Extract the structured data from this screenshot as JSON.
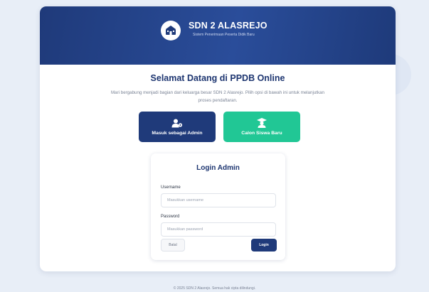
{
  "header": {
    "school_name": "SDN 2 ALASREJO",
    "subtitle": "Sistem Penerimaan Peserta Didik Baru",
    "logo_icon": "school-building-icon"
  },
  "intro": {
    "title": "Selamat Datang di PPDB Online",
    "description": "Mari bergabung menjadi bagian dari keluarga besar SDN 2 Alasrejo. Pilih opsi di bawah ini untuk melanjutkan proses pendaftaran."
  },
  "roles": {
    "admin": {
      "label": "Masuk sebagai Admin",
      "icon": "user-gear-icon",
      "color": "#1f3a7a"
    },
    "siswa": {
      "label": "Calon Siswa Baru",
      "icon": "graduate-icon",
      "color": "#21c795"
    }
  },
  "login": {
    "title": "Login Admin",
    "username_label": "Username",
    "username_placeholder": "Masukkan username",
    "password_label": "Password",
    "password_placeholder": "Masukkan password",
    "cancel_label": "Batal",
    "submit_label": "Login"
  },
  "footer": {
    "text": "© 2025 SDN 2 Alasrejo. Semua hak cipta dilindungi."
  },
  "colors": {
    "primary": "#1f3a7a",
    "accent": "#21c795",
    "background": "#e8eef7"
  }
}
